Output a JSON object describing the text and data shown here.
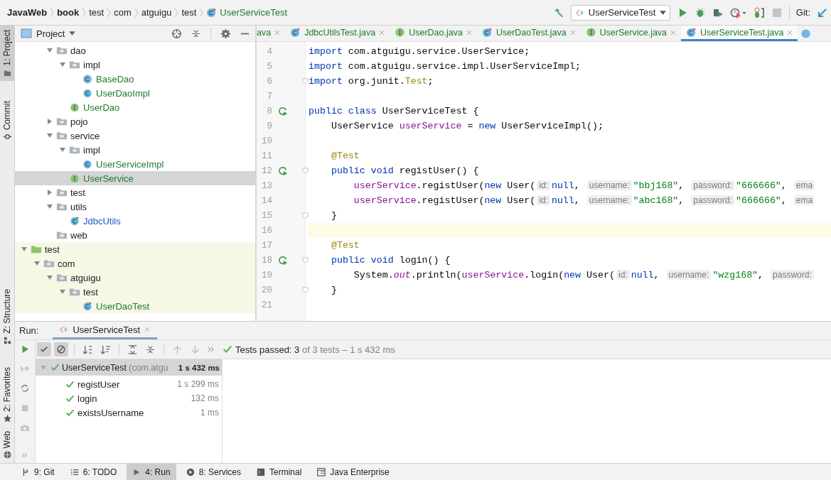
{
  "breadcrumbs": [
    {
      "label": "JavaWeb",
      "kind": "module"
    },
    {
      "label": "book",
      "kind": "module"
    },
    {
      "label": "test",
      "kind": "folder"
    },
    {
      "label": "com",
      "kind": "folder"
    },
    {
      "label": "atguigu",
      "kind": "folder"
    },
    {
      "label": "test",
      "kind": "folder"
    },
    {
      "label": "UserServiceTest",
      "kind": "test_class"
    }
  ],
  "toolbar": {
    "run_config": "UserServiceTest",
    "git_label": "Git:"
  },
  "tool_strip": [
    {
      "label": "1: Project",
      "selected": true,
      "kind": "project"
    },
    {
      "label": "Commit",
      "selected": false,
      "kind": "commit"
    },
    {
      "label": "Z: Structure",
      "selected": false,
      "kind": "structure"
    },
    {
      "label": "2: Favorites",
      "selected": false,
      "kind": "favorites"
    },
    {
      "label": "Web",
      "selected": false,
      "kind": "web"
    }
  ],
  "project_panel": {
    "title": "Project"
  },
  "project_tree": [
    {
      "children": [
        {
          "children": [
            {
              "label": "dao",
              "kind": "package",
              "expanded": true,
              "selected": false,
              "children": [
                {
                  "label": "impl",
                  "kind": "package",
                  "expanded": true,
                  "selected": false,
                  "children": [
                    {
                      "label": "BaseDao",
                      "kind": "abstract_class",
                      "color": "#217a2a",
                      "selected": false
                    },
                    {
                      "label": "UserDaoImpl",
                      "kind": "class",
                      "color": "#217a2a",
                      "selected": false
                    }
                  ]
                },
                {
                  "label": "UserDao",
                  "kind": "interface",
                  "color": "#217a2a",
                  "selected": false
                }
              ]
            },
            {
              "label": "pojo",
              "kind": "package",
              "expanded": false,
              "selected": false
            },
            {
              "label": "service",
              "kind": "package",
              "expanded": true,
              "selected": false,
              "children": [
                {
                  "label": "impl",
                  "kind": "package",
                  "expanded": true,
                  "selected": false,
                  "children": [
                    {
                      "label": "UserServiceImpl",
                      "kind": "class",
                      "color": "#217a2a",
                      "selected": false
                    }
                  ]
                },
                {
                  "label": "UserService",
                  "kind": "interface",
                  "color": "#217a2a",
                  "selected": true
                }
              ]
            },
            {
              "label": "test",
              "kind": "package",
              "expanded": false,
              "selected": false
            },
            {
              "label": "utils",
              "kind": "package",
              "expanded": true,
              "selected": false,
              "children": [
                {
                  "label": "JdbcUtils",
                  "kind": "runnable_class",
                  "color": "#2456c2",
                  "selected": false
                }
              ]
            },
            {
              "label": "web",
              "kind": "package",
              "selected": false
            }
          ]
        }
      ]
    },
    {
      "label": "test",
      "kind": "test_root",
      "expanded": true,
      "selected": false,
      "children": [
        {
          "label": "com",
          "kind": "package",
          "expanded": true,
          "selected": false,
          "children": [
            {
              "label": "atguigu",
              "kind": "package",
              "expanded": true,
              "selected": false,
              "children": [
                {
                  "label": "test",
                  "kind": "package",
                  "expanded": true,
                  "selected": false,
                  "children": [
                    {
                      "label": "UserDaoTest",
                      "kind": "test_class",
                      "color": "#217a2a",
                      "selected": false
                    }
                  ]
                }
              ]
            }
          ]
        }
      ]
    }
  ],
  "editor_tabs": [
    {
      "label": "ava",
      "kind": "none",
      "selected": false
    },
    {
      "label": "JdbcUtilsTest.java",
      "kind": "test_class",
      "selected": false
    },
    {
      "label": "UserDao.java",
      "kind": "interface",
      "selected": false
    },
    {
      "label": "UserDaoTest.java",
      "kind": "test_class",
      "selected": false
    },
    {
      "label": "UserService.java",
      "kind": "interface",
      "selected": false
    },
    {
      "label": "UserServiceTest.java",
      "kind": "test_class",
      "selected": true
    }
  ],
  "code_lines": [
    {
      "number": "4",
      "segments": [
        {
          "kind": "kw",
          "text": "import"
        },
        {
          "kind": "plain",
          "text": " com.atguigu.service.UserService;"
        }
      ]
    },
    {
      "number": "5",
      "segments": [
        {
          "kind": "kw",
          "text": "import"
        },
        {
          "kind": "plain",
          "text": " com.atguigu.service.impl.UserServiceImpl;"
        }
      ]
    },
    {
      "number": "6",
      "fold": true,
      "segments": [
        {
          "kind": "kw",
          "text": "import"
        },
        {
          "kind": "plain",
          "text": " org.junit."
        },
        {
          "kind": "ann",
          "text": "Test"
        },
        {
          "kind": "plain",
          "text": ";"
        }
      ]
    },
    {
      "number": "7"
    },
    {
      "number": "8",
      "run": true,
      "segments": [
        {
          "kind": "kw",
          "text": "public class"
        },
        {
          "kind": "plain",
          "text": " UserServiceTest {"
        }
      ]
    },
    {
      "number": "9",
      "segments": [
        {
          "kind": "plain",
          "text": "    UserService "
        },
        {
          "kind": "field",
          "text": "userService"
        },
        {
          "kind": "plain",
          "text": " = "
        },
        {
          "kind": "kw",
          "text": "new"
        },
        {
          "kind": "plain",
          "text": " UserServiceImpl();"
        }
      ]
    },
    {
      "number": "10"
    },
    {
      "number": "11",
      "segments": [
        {
          "kind": "ann",
          "text": "    @Test"
        }
      ]
    },
    {
      "number": "12",
      "run": true,
      "fold": true,
      "segments": [
        {
          "kind": "kw",
          "text": "    public void"
        },
        {
          "kind": "plain",
          "text": " registUser() {"
        }
      ]
    },
    {
      "number": "13",
      "segments": [
        {
          "kind": "field",
          "text": "        userService"
        },
        {
          "kind": "plain",
          "text": ".registUser("
        },
        {
          "kind": "kw",
          "text": "new"
        },
        {
          "kind": "plain",
          "text": " User("
        },
        {
          "kind": "hint",
          "text": "id:"
        },
        {
          "kind": "kw",
          "text": "null"
        },
        {
          "kind": "plain",
          "text": ", "
        },
        {
          "kind": "hint",
          "text": "username:"
        },
        {
          "kind": "str",
          "text": "\"bbj168\""
        },
        {
          "kind": "plain",
          "text": ", "
        },
        {
          "kind": "hint",
          "text": "password:"
        },
        {
          "kind": "str",
          "text": "\"666666\""
        },
        {
          "kind": "plain",
          "text": ", "
        },
        {
          "kind": "hint",
          "text": "ema"
        }
      ]
    },
    {
      "number": "14",
      "segments": [
        {
          "kind": "field",
          "text": "        userService"
        },
        {
          "kind": "plain",
          "text": ".registUser("
        },
        {
          "kind": "kw",
          "text": "new"
        },
        {
          "kind": "plain",
          "text": " User("
        },
        {
          "kind": "hint",
          "text": "id:"
        },
        {
          "kind": "kw",
          "text": "null"
        },
        {
          "kind": "plain",
          "text": ", "
        },
        {
          "kind": "hint",
          "text": "username:"
        },
        {
          "kind": "str",
          "text": "\"abc168\""
        },
        {
          "kind": "plain",
          "text": ", "
        },
        {
          "kind": "hint",
          "text": "password:"
        },
        {
          "kind": "str",
          "text": "\"666666\""
        },
        {
          "kind": "plain",
          "text": ", "
        },
        {
          "kind": "hint",
          "text": "ema"
        }
      ]
    },
    {
      "number": "15",
      "fold": true,
      "segments": [
        {
          "kind": "plain",
          "text": "    }"
        }
      ]
    },
    {
      "number": "16",
      "current": true
    },
    {
      "number": "17",
      "segments": [
        {
          "kind": "ann",
          "text": "    @Test"
        }
      ]
    },
    {
      "number": "18",
      "run": true,
      "fold": true,
      "segments": [
        {
          "kind": "kw",
          "text": "    public void"
        },
        {
          "kind": "plain",
          "text": " login() {"
        }
      ]
    },
    {
      "number": "19",
      "segments": [
        {
          "kind": "plain",
          "text": "        System."
        },
        {
          "kind": "static",
          "text": "out"
        },
        {
          "kind": "plain",
          "text": ".println("
        },
        {
          "kind": "field",
          "text": "userService"
        },
        {
          "kind": "plain",
          "text": ".login("
        },
        {
          "kind": "kw",
          "text": "new"
        },
        {
          "kind": "plain",
          "text": " User("
        },
        {
          "kind": "hint",
          "text": "id:"
        },
        {
          "kind": "kw",
          "text": "null"
        },
        {
          "kind": "plain",
          "text": ", "
        },
        {
          "kind": "hint",
          "text": "username:"
        },
        {
          "kind": "str",
          "text": "\"wzg168\""
        },
        {
          "kind": "plain",
          "text": ", "
        },
        {
          "kind": "hint",
          "text": "password:"
        }
      ]
    },
    {
      "number": "20",
      "fold": true,
      "segments": [
        {
          "kind": "plain",
          "text": "    }"
        }
      ]
    },
    {
      "number": "21"
    }
  ],
  "run_panel": {
    "title": "Run:",
    "tab": "UserServiceTest",
    "status_bold": "Tests passed: 3",
    "status_rest": "of 3 tests – 1 s 432 ms",
    "filters": [
      {
        "kind": "passed",
        "on": true
      },
      {
        "kind": "ignored",
        "on": true
      }
    ],
    "tests": [
      {
        "label": "UserServiceTest",
        "package": "(com.atgu",
        "time": "1 s 432 ms",
        "selected": true,
        "children": [
          {
            "label": "registUser",
            "time": "1 s 299 ms",
            "selected": false
          },
          {
            "label": "login",
            "time": "132 ms",
            "selected": false
          },
          {
            "label": "existsUsername",
            "time": "1 ms",
            "selected": false
          }
        ]
      }
    ]
  },
  "bottom_tools": [
    {
      "label": "9: Git",
      "kind": "git",
      "selected": false
    },
    {
      "label": "6: TODO",
      "kind": "todo",
      "selected": false
    },
    {
      "label": "4: Run",
      "kind": "run",
      "selected": true
    },
    {
      "label": "8: Services",
      "kind": "services",
      "selected": false
    },
    {
      "label": "Terminal",
      "kind": "terminal",
      "selected": false
    },
    {
      "label": "Java Enterprise",
      "kind": "enterprise",
      "selected": false
    }
  ]
}
